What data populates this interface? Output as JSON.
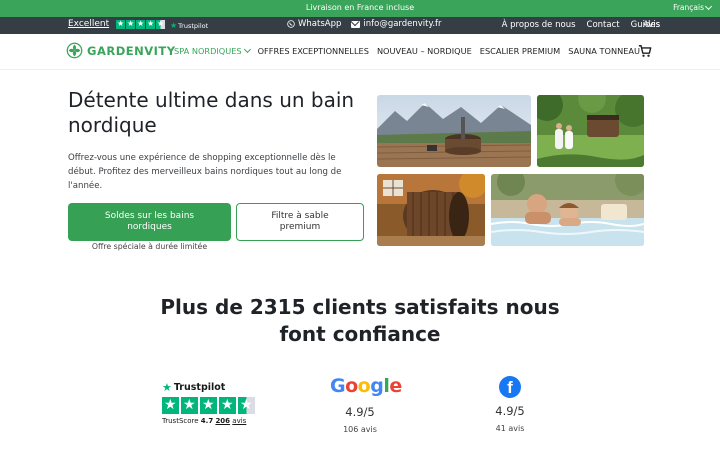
{
  "topbar": {
    "shipping": "Livraison en France incluse",
    "language": "Français"
  },
  "darkbar": {
    "trustpilot_label": "Excellent",
    "trustpilot_brand": "Trustpilot",
    "whatsapp": "WhatsApp",
    "email": "info@gardenvity.fr",
    "links": [
      "À propos de nous",
      "Contact",
      "Guides",
      "Avis"
    ]
  },
  "nav": {
    "logo": "GARDENVITY",
    "items": [
      "SPA NORDIQUES",
      "OFFRES EXCEPTIONNELLES",
      "NOUVEAU – NORDIQUE",
      "ESCALIER PREMIUM",
      "SAUNA TONNEAU"
    ],
    "cart_icon": "cart-icon"
  },
  "hero": {
    "title": "Détente ultime dans un bain nordique",
    "text": "Offrez-vous une expérience de shopping exceptionnelle dès le début. Profitez des merveilleux bains nordiques tout au long de l'année.",
    "primary_button": "Soldes sur les bains nordiques",
    "secondary_button": "Filtre à sable premium",
    "offer_note": "Offre spéciale à durée limitée"
  },
  "trust": {
    "title": "Plus de 2315 clients satisfaits nous font confiance",
    "trustpilot": {
      "brand": "Trustpilot",
      "score_label": "TrustScore",
      "score": "4.7",
      "reviews": "206",
      "reviews_label": "avis",
      "stars": 4.5
    },
    "google": {
      "brand": "Google",
      "rating": "4.9/5",
      "count": "106 avis"
    },
    "facebook": {
      "rating": "4.9/5",
      "count": "41 avis"
    }
  },
  "colors": {
    "accent": "#3aa55a",
    "dark": "#343e44",
    "trustpilot": "#00b67a",
    "facebook": "#1877f2"
  }
}
